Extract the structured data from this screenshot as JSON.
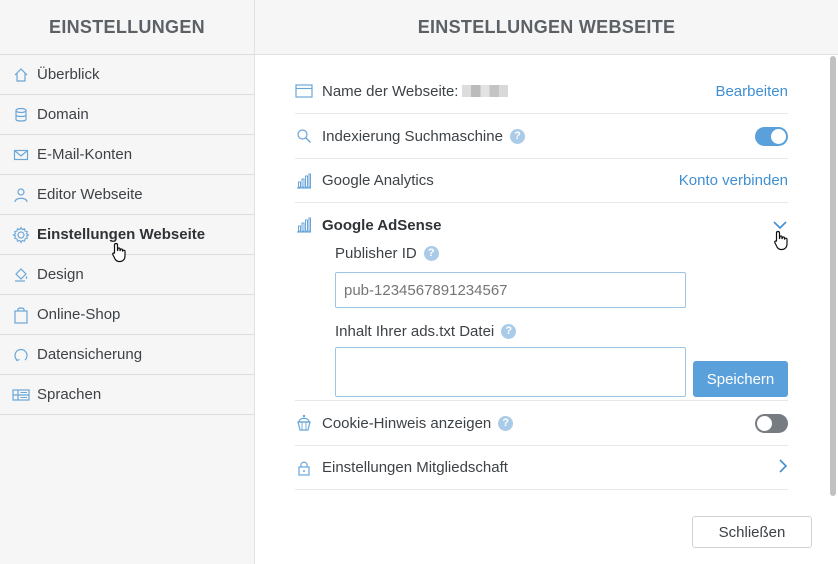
{
  "sidebar": {
    "title": "EINSTELLUNGEN",
    "items": [
      {
        "label": "Überblick",
        "icon": "home-icon"
      },
      {
        "label": "Domain",
        "icon": "database-icon"
      },
      {
        "label": "E-Mail-Konten",
        "icon": "mail-icon"
      },
      {
        "label": "Editor Webseite",
        "icon": "user-icon"
      },
      {
        "label": "Einstellungen Webseite",
        "icon": "gear-icon",
        "active": true
      },
      {
        "label": "Design",
        "icon": "paint-bucket-icon"
      },
      {
        "label": "Online-Shop",
        "icon": "shopping-bag-icon"
      },
      {
        "label": "Datensicherung",
        "icon": "backup-icon"
      },
      {
        "label": "Sprachen",
        "icon": "languages-icon"
      }
    ]
  },
  "main": {
    "title": "EINSTELLUNGEN WEBSEITE",
    "site_name": {
      "label": "Name der Webseite:",
      "action": "Bearbeiten"
    },
    "indexing": {
      "label": "Indexierung Suchmaschine",
      "help": "?",
      "enabled": true
    },
    "analytics": {
      "label": "Google Analytics",
      "action": "Konto verbinden"
    },
    "adsense": {
      "label": "Google AdSense",
      "expanded": true,
      "publisher_label": "Publisher ID",
      "publisher_help": "?",
      "publisher_placeholder": "pub-1234567891234567",
      "ads_label": "Inhalt Ihrer ads.txt Datei",
      "ads_help": "?",
      "ads_value": "",
      "save_label": "Speichern"
    },
    "cookie": {
      "label": "Cookie-Hinweis anzeigen",
      "help": "?",
      "enabled": false
    },
    "membership": {
      "label": "Einstellungen Mitgliedschaft"
    },
    "close_label": "Schließen"
  },
  "colors": {
    "accent": "#5aa0db",
    "link": "#3f8fd2",
    "toggle_off": "#777c82"
  }
}
